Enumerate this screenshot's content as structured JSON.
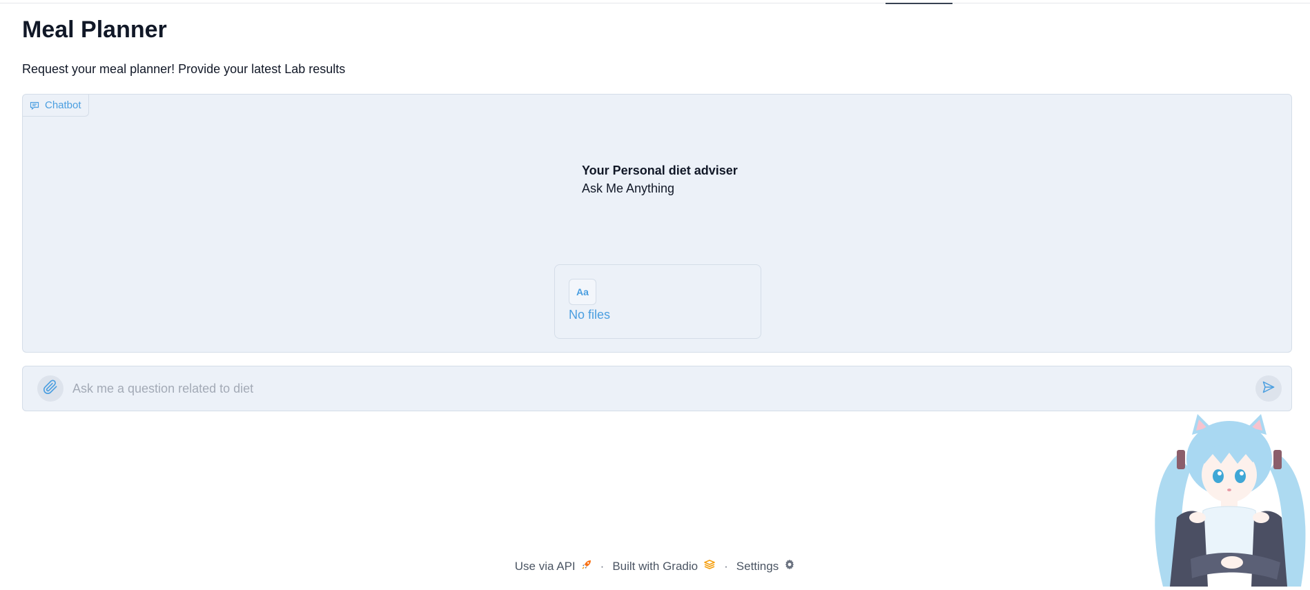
{
  "header": {
    "title": "Meal Planner",
    "description": "Request your meal planner! Provide your latest Lab results"
  },
  "chatbot": {
    "label": "Chatbot",
    "placeholder_heading": "Your Personal diet adviser",
    "placeholder_sub": "Ask Me Anything",
    "files_badge": "Aa",
    "files_text": "No files"
  },
  "input": {
    "placeholder": "Ask me a question related to diet",
    "value": ""
  },
  "footer": {
    "api_label": "Use via API",
    "separator": "·",
    "built_label": "Built with Gradio",
    "settings_label": "Settings"
  },
  "icons": {
    "chatbot_label_icon": "chat-bubble-icon",
    "attach": "paperclip-icon",
    "send": "send-icon",
    "api": "rocket-icon",
    "gradio": "gradio-logo-icon",
    "settings": "gear-icon"
  },
  "colors": {
    "accent": "#4a9ee0",
    "panel_bg": "#ecf1f8",
    "border": "#d4dde8",
    "gradio_orange": "#f59e0b"
  }
}
